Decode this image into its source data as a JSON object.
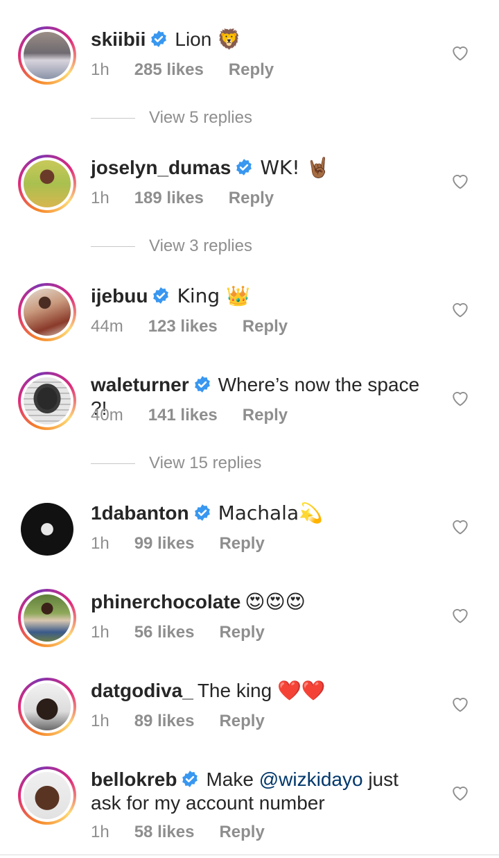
{
  "colors": {
    "verified_blue": "#3897f0",
    "meta_grey": "#8e8e8e",
    "mention_blue": "#00376b"
  },
  "comments": [
    {
      "username": "skiibii",
      "verified": true,
      "text": "Lion 🦁",
      "time": "1h",
      "likes": "285 likes",
      "reply": "Reply",
      "view_replies": "View 5 replies"
    },
    {
      "username": "joselyn_dumas",
      "verified": true,
      "text": "WK! 🤘🏾",
      "time": "1h",
      "likes": "189 likes",
      "reply": "Reply",
      "view_replies": "View 3 replies"
    },
    {
      "username": "ijebuu",
      "verified": true,
      "text": "King 👑",
      "time": "44m",
      "likes": "123 likes",
      "reply": "Reply"
    },
    {
      "username": "waleturner",
      "verified": true,
      "text": "Where’s now the space ?!",
      "time": "40m",
      "likes": "141 likes",
      "reply": "Reply",
      "view_replies": "View 15 replies"
    },
    {
      "username": "1dabanton",
      "verified": true,
      "text": "Machala💫",
      "time": "1h",
      "likes": "99 likes",
      "reply": "Reply"
    },
    {
      "username": "phinerchocolate",
      "verified": false,
      "text": "😍😍😍",
      "time": "1h",
      "likes": "56 likes",
      "reply": "Reply"
    },
    {
      "username": "datgodiva_",
      "verified": false,
      "text": "The king ❤️❤️",
      "time": "1h",
      "likes": "89 likes",
      "reply": "Reply"
    },
    {
      "username": "bellokreb",
      "verified": true,
      "text_before": "Make ",
      "mention": "@wizkidayo",
      "text_after": " just ask for my account number",
      "time": "1h",
      "likes": "58 likes",
      "reply": "Reply"
    }
  ],
  "icons": {
    "heart": "heart-outline-icon",
    "verified": "verified-badge-icon"
  }
}
